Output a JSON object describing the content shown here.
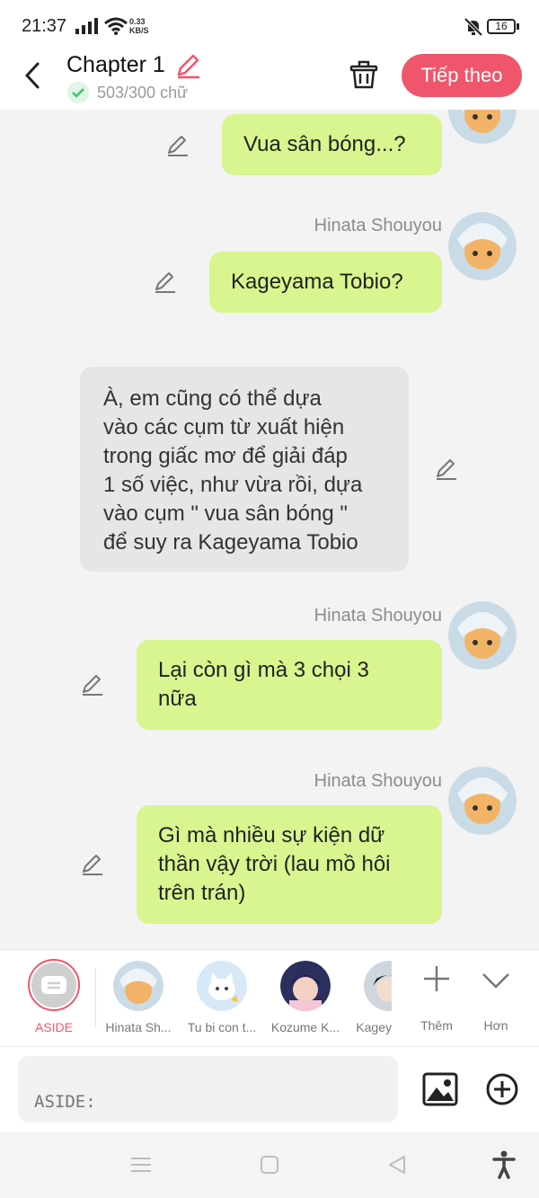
{
  "status_bar": {
    "time": "21:37",
    "speed_value": "0.33",
    "speed_unit": "KB/S",
    "battery": "16"
  },
  "header": {
    "title": "Chapter 1",
    "word_count": "503/300 chữ",
    "next_label": "Tiếp theo",
    "accent": "#f0566b"
  },
  "messages": [
    {
      "type": "me",
      "text": "Vua sân bóng...?"
    },
    {
      "type": "me",
      "sender": "Hinata Shouyou",
      "text": "Kageyama Tobio?"
    },
    {
      "type": "aside",
      "lines": [
        "À, em cũng có thể dựa",
        "vào các cụm từ xuất hiện",
        "trong giấc mơ để giải đáp",
        "1 số việc, như vừa rồi, dựa",
        "vào cụm \" vua sân bóng \"",
        "để suy ra Kageyama Tobio"
      ]
    },
    {
      "type": "me",
      "sender": "Hinata Shouyou",
      "lines": [
        "Lại còn gì mà 3 chọi 3",
        "nữa"
      ]
    },
    {
      "type": "me",
      "sender": "Hinata Shouyou",
      "lines": [
        "Gì mà nhiều sự kiện dữ",
        "thần vậy trời (lau mồ hôi",
        "trên trán)"
      ]
    }
  ],
  "characters": [
    {
      "label": "ASIDE",
      "active": true
    },
    {
      "label": "Hinata Sh..."
    },
    {
      "label": "Tu bi con t..."
    },
    {
      "label": "Kozume K..."
    },
    {
      "label": "Kagey"
    }
  ],
  "actions": {
    "more_label": "Thêm",
    "expand_label": "Hơn"
  },
  "input": {
    "placeholder": "ASIDE:"
  },
  "colors": {
    "bubble_me": "#d8f58f",
    "bubble_aside": "#e6e6e6",
    "check": "#3cc46b"
  }
}
